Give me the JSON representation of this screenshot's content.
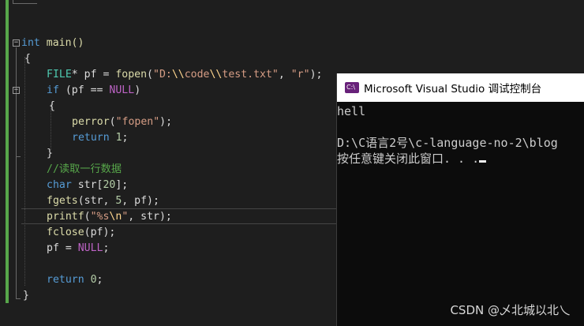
{
  "editor": {
    "lines": {
      "main_sig": {
        "kw": "int",
        "name": " main()"
      },
      "open_brace": "{",
      "fopen": {
        "type": "FILE",
        "rest": "* pf = ",
        "fn": "fopen",
        "p1": "(",
        "str_a": "\"D:",
        "esc1": "\\\\",
        "str_b": "code",
        "esc2": "\\\\",
        "str_c": "test.txt\"",
        "comma": ", ",
        "mode": "\"r\"",
        "end": ");"
      },
      "if_check": {
        "kw": "if",
        "a": " (pf == ",
        "macro": "NULL",
        "b": ")"
      },
      "if_open": "{",
      "perror": {
        "fn": "perror",
        "a": "(",
        "str": "\"fopen\"",
        "b": ");"
      },
      "return_1": {
        "kw": "return",
        "num": " 1",
        "semi": ";"
      },
      "if_close": "}",
      "comment": "//读取一行数据",
      "decl": {
        "kw": "char",
        "rest": " str[",
        "num": "20",
        "end": "];"
      },
      "fgets": {
        "fn": "fgets",
        "a": "(str, ",
        "num": "5",
        "b": ", pf);"
      },
      "printf": {
        "fn": "printf",
        "a": "(",
        "str_a": "\"%s",
        "esc": "\\n",
        "str_b": "\"",
        "b": ", str);"
      },
      "fclose": {
        "fn": "fclose",
        "a": "(pf);"
      },
      "null_assign": {
        "a": "pf = ",
        "macro": "NULL",
        "b": ";"
      },
      "return_0": {
        "kw": "return",
        "num": " 0",
        "semi": ";"
      },
      "close_brace": "}"
    },
    "fold_minus": "−"
  },
  "console": {
    "icon_text": "C:\\",
    "title": "Microsoft Visual Studio 调试控制台",
    "lines": [
      "hell",
      "",
      "D:\\C语言2号\\c-language-no-2\\blog",
      "按任意键关闭此窗口. . ."
    ]
  },
  "watermark": "CSDN @乄北城以北乀",
  "colors": {
    "editor_bg": "#1e1e1e",
    "console_bg": "#0c0c0c",
    "keyword": "#569cd6",
    "type": "#4ec9b0",
    "function": "#dcdcaa",
    "string": "#d69d85",
    "comment": "#57a64a",
    "macro": "#bd63c5",
    "vs_purple": "#68217a"
  }
}
